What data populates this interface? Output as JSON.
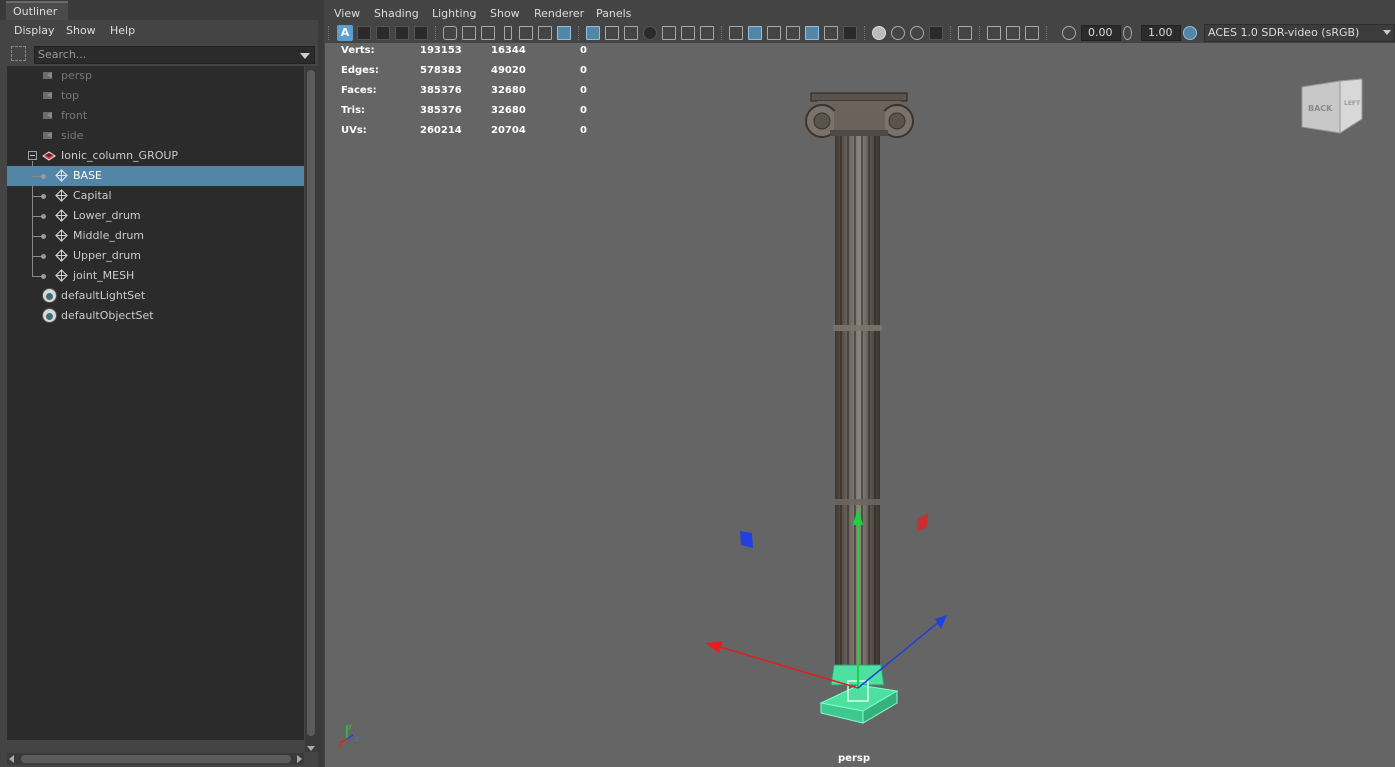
{
  "outliner": {
    "tab_label": "Outliner",
    "menu": [
      "Display",
      "Show",
      "Help"
    ],
    "search_placeholder": "Search...",
    "items": [
      {
        "label": "persp",
        "icon": "camera-icon"
      },
      {
        "label": "top",
        "icon": "camera-icon"
      },
      {
        "label": "front",
        "icon": "camera-icon"
      },
      {
        "label": "side",
        "icon": "camera-icon"
      },
      {
        "label": "Ionic_column_GROUP",
        "icon": "group-icon"
      },
      {
        "label": "BASE",
        "icon": "mesh-icon",
        "selected": true
      },
      {
        "label": "Capital",
        "icon": "mesh-icon"
      },
      {
        "label": "Lower_drum",
        "icon": "mesh-icon"
      },
      {
        "label": "Middle_drum",
        "icon": "mesh-icon"
      },
      {
        "label": "Upper_drum",
        "icon": "mesh-icon"
      },
      {
        "label": "joint_MESH",
        "icon": "mesh-icon"
      },
      {
        "label": "defaultLightSet",
        "icon": "set-icon"
      },
      {
        "label": "defaultObjectSet",
        "icon": "set-icon"
      }
    ]
  },
  "viewport": {
    "menu": [
      "View",
      "Shading",
      "Lighting",
      "Show",
      "Renderer",
      "Panels"
    ],
    "toolbar": {
      "exposure_value": "0.00",
      "gamma_value": "1.00",
      "color_space": "ACES 1.0 SDR-video (sRGB)"
    },
    "hud": [
      {
        "label": "Verts:",
        "total": "193153",
        "selected": "16344",
        "components": "0"
      },
      {
        "label": "Edges:",
        "total": "578383",
        "selected": "49020",
        "components": "0"
      },
      {
        "label": "Faces:",
        "total": "385376",
        "selected": "32680",
        "components": "0"
      },
      {
        "label": "Tris:",
        "total": "385376",
        "selected": "32680",
        "components": "0"
      },
      {
        "label": "UVs:",
        "total": "260214",
        "selected": "20704",
        "components": "0"
      }
    ],
    "camera_name": "persp",
    "viewcube": {
      "front_label": "BACK",
      "side_label": "LEFT"
    },
    "axis_labels": [
      "y",
      "x",
      "z"
    ]
  },
  "colors": {
    "selection_highlight": "#5285a6",
    "viewport_bg": "#656565",
    "selected_mesh": "#4de0a0",
    "manipulator_x": "#e02020",
    "manipulator_y": "#20d040",
    "manipulator_z": "#2040e0"
  }
}
